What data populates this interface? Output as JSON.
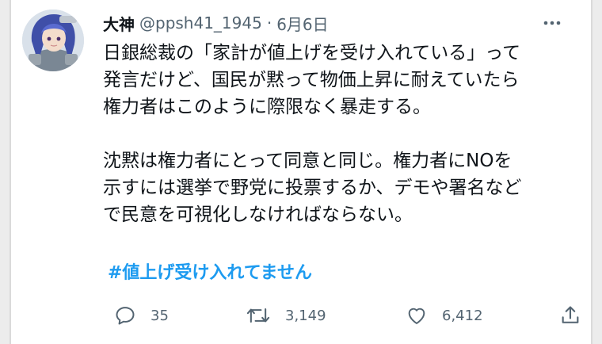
{
  "tweet": {
    "display_name": "大神",
    "handle": "@ppsh41_1945",
    "separator": "·",
    "date": "6月6日",
    "more_icon": "more-horizontal-icon",
    "text": "日銀総裁の「家計が値上げを受け入れている」って\n発言だけど、国民が黙って物価上昇に耐えていたら\n権力者はこのように際限なく暴走する。\n\n沈黙は権力者にとって同意と同じ。権力者にNOを\n示すには選挙で野党に投票するか、デモや署名など\nで民意を可視化しなければならない。",
    "hashtag": "#値上げ受け入れてません"
  },
  "actions": {
    "reply": {
      "icon": "reply-icon",
      "count": "35"
    },
    "retweet": {
      "icon": "retweet-icon",
      "count": "3,149"
    },
    "like": {
      "icon": "heart-icon",
      "count": "6,412"
    },
    "share": {
      "icon": "share-icon"
    }
  },
  "colors": {
    "text": "#0f1419",
    "secondary": "#536471",
    "accent": "#1d9bf0"
  }
}
